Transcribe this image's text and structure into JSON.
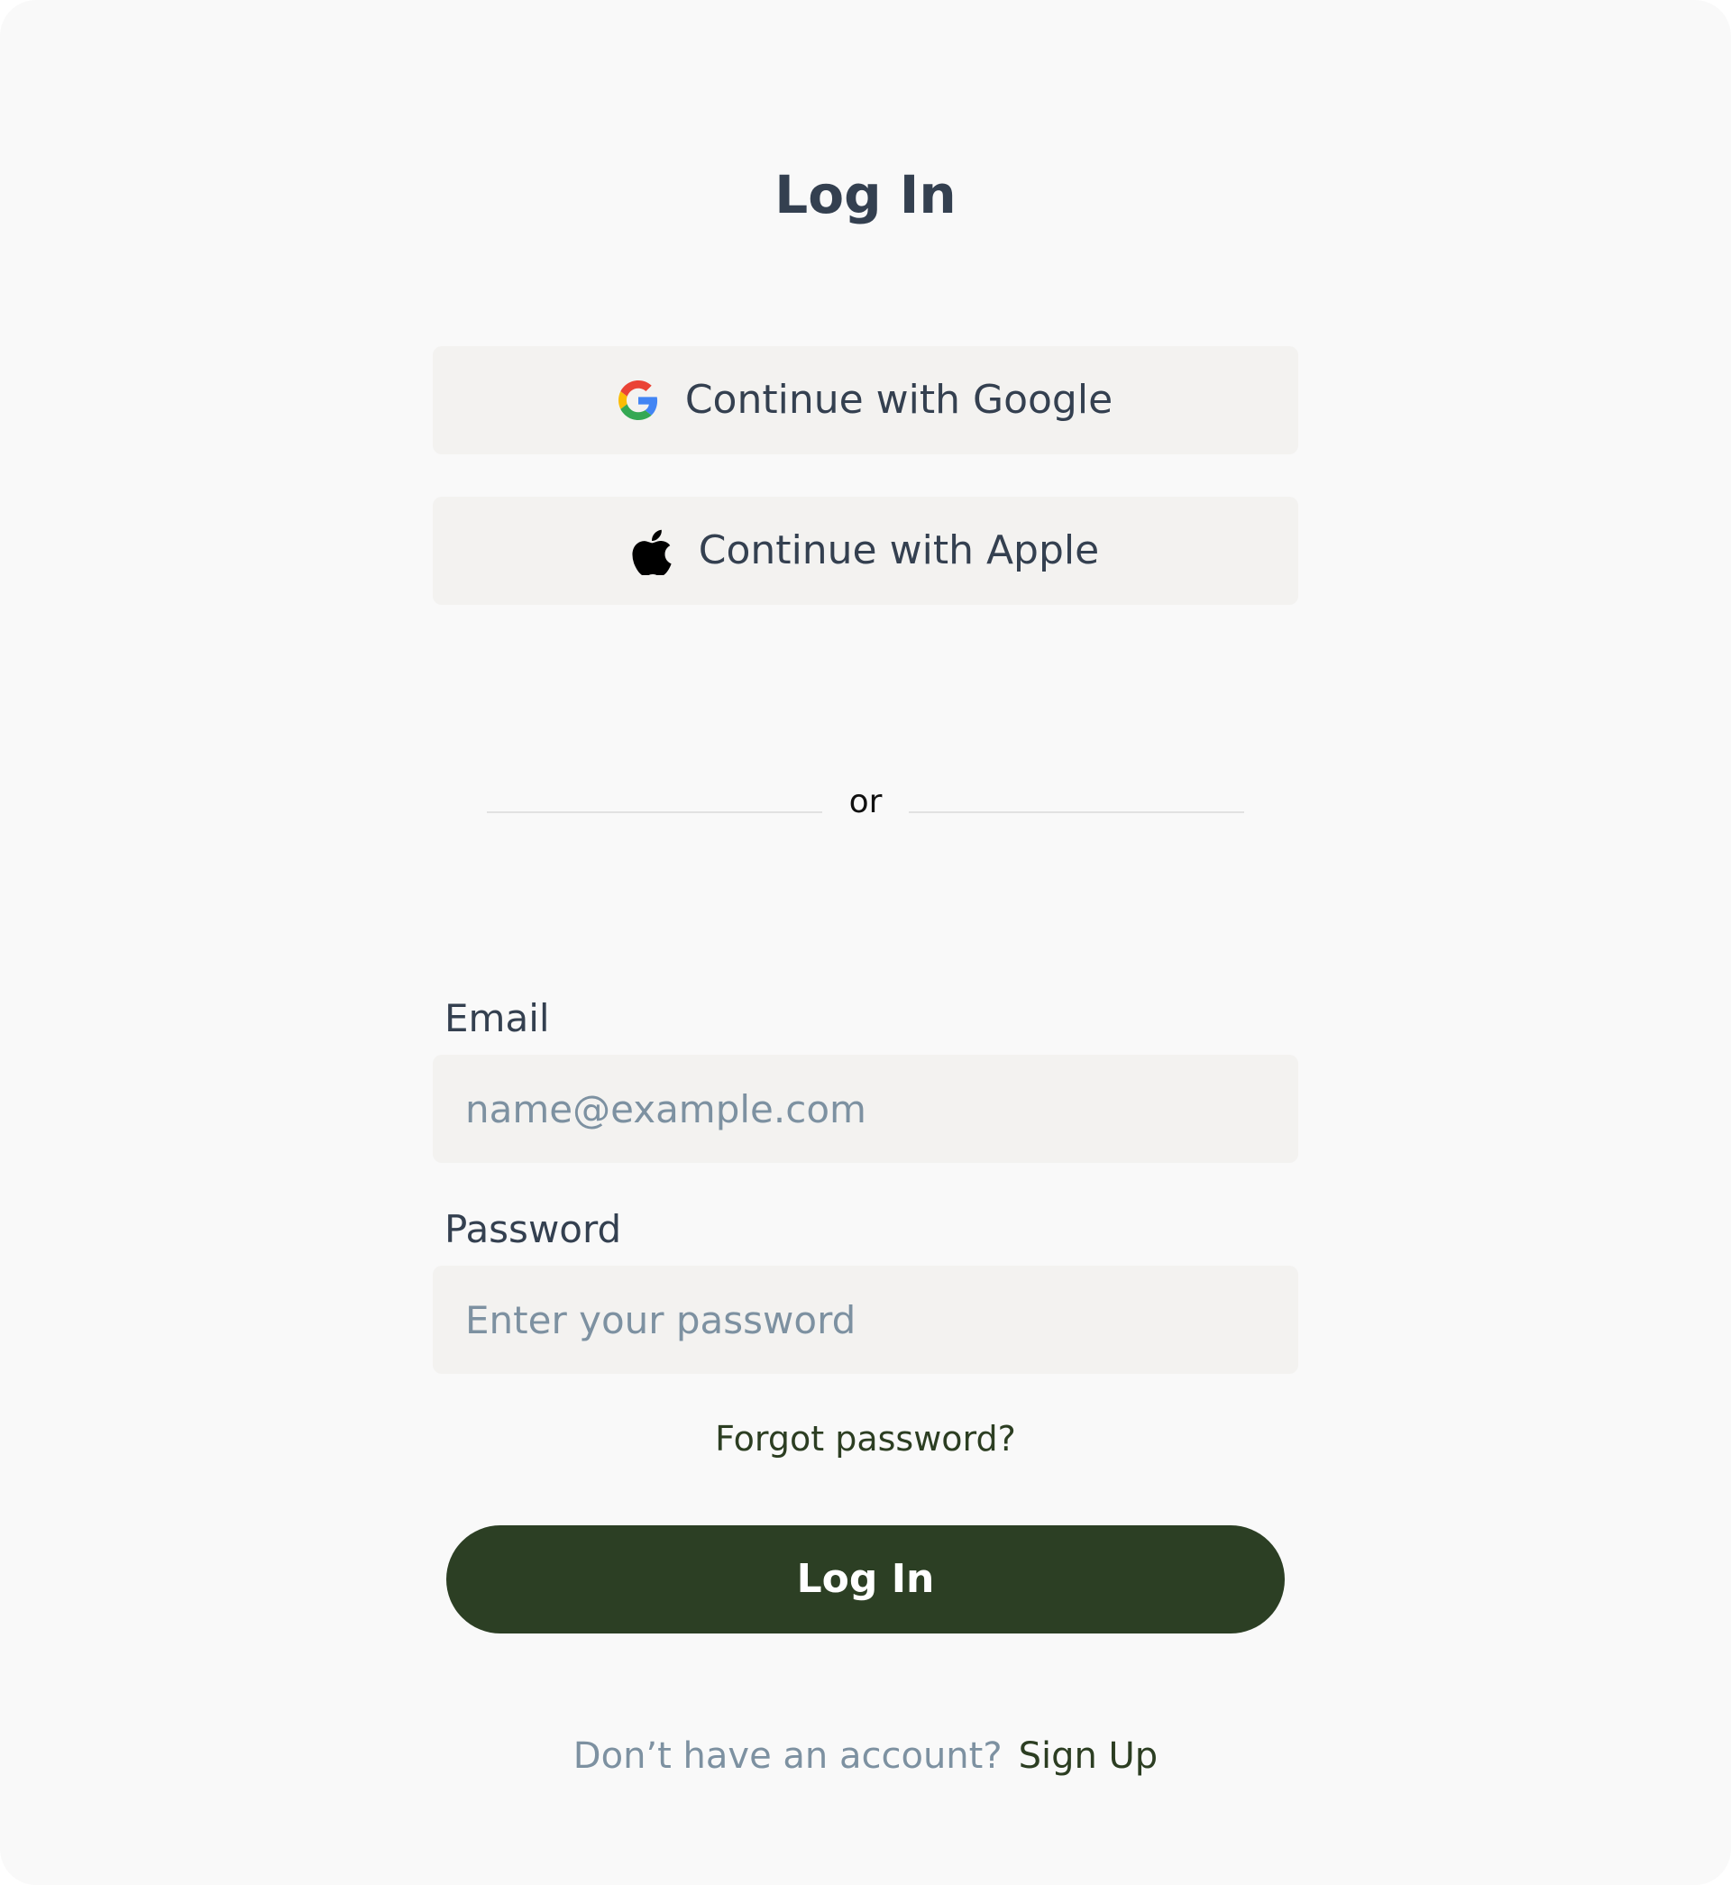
{
  "page": {
    "title": "Log In"
  },
  "social": {
    "google_label": "Continue with Google",
    "apple_label": "Continue with Apple"
  },
  "divider": {
    "text": "or"
  },
  "form": {
    "email": {
      "label": "Email",
      "placeholder": "name@example.com",
      "value": ""
    },
    "password": {
      "label": "Password",
      "placeholder": "Enter your password",
      "value": ""
    },
    "forgot_label": "Forgot password?",
    "submit_label": "Log In"
  },
  "footer": {
    "prompt": "Don’t have an account?",
    "signup_label": "Sign Up"
  },
  "icons": {
    "google": "google-icon",
    "apple": "apple-icon"
  },
  "colors": {
    "background": "#f9f9f9",
    "button_bg": "#f3f2f0",
    "primary": "#2c3f24",
    "text": "#344050",
    "placeholder": "#7d91a1",
    "link": "#2c3e22"
  }
}
